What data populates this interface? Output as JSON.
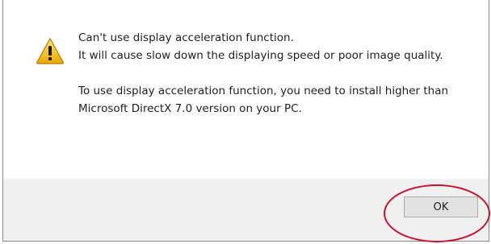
{
  "dialog": {
    "icon": "warning-icon",
    "message_line_1": "Can't use display acceleration function.",
    "message_line_2": "It will cause slow down the displaying speed or poor image quality.",
    "message_line_3": "To use display acceleration function, you need to install higher than Microsoft DirectX 7.0 version on your PC.",
    "ok_label": "OK"
  },
  "colors": {
    "highlight": "#c8102e",
    "warning_fill": "#f5c400",
    "button_bar": "#f0f0f0"
  }
}
